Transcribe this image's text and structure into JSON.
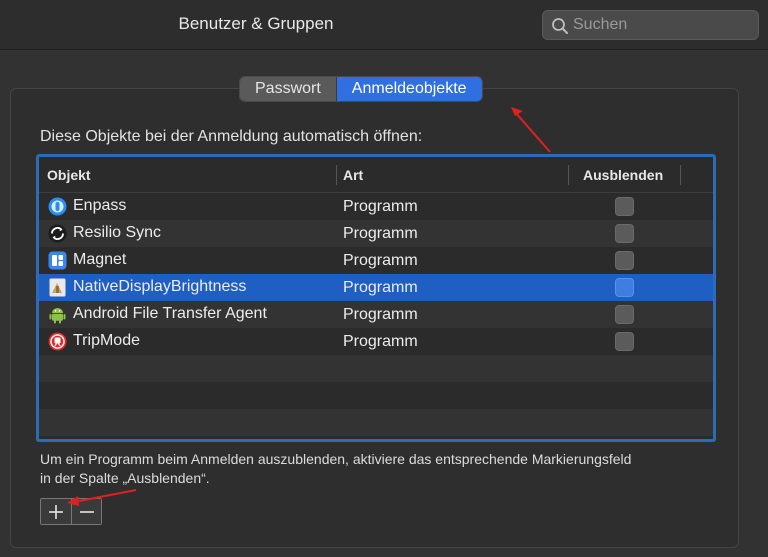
{
  "window": {
    "title": "Benutzer & Gruppen"
  },
  "search": {
    "placeholder": "Suchen"
  },
  "tabs": [
    {
      "label": "Passwort",
      "active": false
    },
    {
      "label": "Anmeldeobjekte",
      "active": true
    }
  ],
  "heading": "Diese Objekte bei der Anmeldung automatisch öffnen:",
  "table": {
    "columns": [
      "Objekt",
      "Art",
      "Ausblenden"
    ],
    "rows": [
      {
        "name": "Enpass",
        "art": "Programm",
        "icon": "enpass-icon",
        "selected": false
      },
      {
        "name": "Resilio Sync",
        "art": "Programm",
        "icon": "resilio-sync-icon",
        "selected": false
      },
      {
        "name": "Magnet",
        "art": "Programm",
        "icon": "magnet-icon",
        "selected": false
      },
      {
        "name": "NativeDisplayBrightness",
        "art": "Programm",
        "icon": "app-generic-icon",
        "selected": true
      },
      {
        "name": "Android File Transfer Agent",
        "art": "Programm",
        "icon": "android-icon",
        "selected": false
      },
      {
        "name": "TripMode",
        "art": "Programm",
        "icon": "tripmode-icon",
        "selected": false
      }
    ]
  },
  "hint": "Um ein Programm beim Anmelden auszublenden, aktiviere das entsprechende Markierungsfeld in der Spalte „Ausblenden“.",
  "buttons": {
    "add": "+",
    "remove": "−"
  },
  "colors": {
    "accent": "#2f6fe0",
    "selection": "#1f5fc4",
    "annotation": "#e0201f"
  }
}
